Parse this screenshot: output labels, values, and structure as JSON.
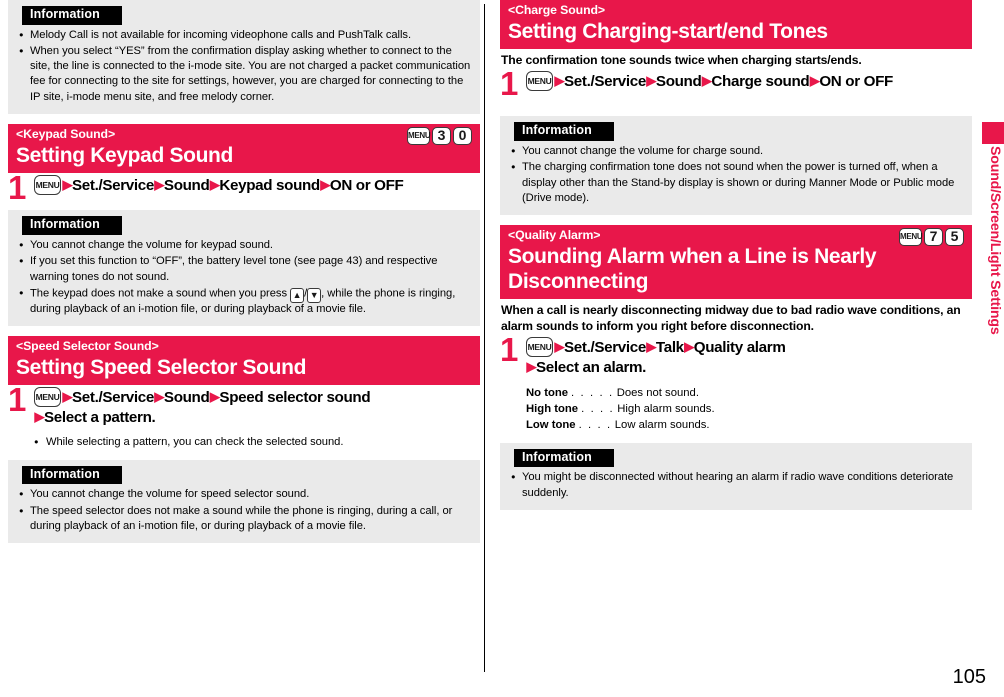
{
  "page": {
    "number": "105",
    "sidebar_label": "Sound/Screen/Light Settings",
    "accent_color": "#E8174A",
    "info_title": "Information"
  },
  "left_column": {
    "info_top": {
      "title": "Information",
      "bullets": [
        "Melody Call is not available for incoming videophone calls and PushTalk calls.",
        "When you select “YES” from the confirmation display asking whether to connect to the site, the line is connected to the i-mode site. You are not charged a packet communication fee for connecting to the site for settings, however, you are charged for connecting to the IP site, i-mode menu site, and free melody corner."
      ]
    },
    "section_keypad": {
      "subtitle": "<Keypad Sound>",
      "title": "Setting Keypad Sound",
      "keys": [
        "MENU",
        "3",
        "0"
      ],
      "step_number": "1",
      "step_menu_key": "MENU",
      "step_items": [
        "Set./Service",
        "Sound",
        "Keypad sound",
        "ON or OFF"
      ],
      "info": {
        "title": "Information",
        "bullets": [
          "You cannot change the volume for keypad sound.",
          "If you set this function to “OFF”, the battery level tone (see page 43) and respective warning tones do not sound.",
          "The keypad does not make a sound when you press ▲/▼, while the phone is ringing, during playback of an i-motion file, or during playback of a movie file."
        ],
        "bullet3_part1": "The keypad does not make a sound when you press ",
        "bullet3_part2": ", while the phone is ringing, during playback of an i-motion file, or during playback of a movie file.",
        "key_up": "▲",
        "key_down": "▼",
        "key_separator": "/"
      }
    },
    "section_speed_selector": {
      "subtitle": "<Speed Selector Sound>",
      "title": "Setting Speed Selector Sound",
      "step_number": "1",
      "step_menu_key": "MENU",
      "step_items": [
        "Set./Service",
        "Sound",
        "Speed selector sound"
      ],
      "step_line2": "Select a pattern.",
      "subnote": "While selecting a pattern, you can check the selected sound.",
      "info": {
        "title": "Information",
        "bullets": [
          "You cannot change the volume for speed selector sound.",
          "The speed selector does not make a sound while the phone is ringing, during a call, or during playback of an i-motion file, or during playback of a movie file."
        ]
      }
    }
  },
  "right_column": {
    "section_charge": {
      "subtitle": "<Charge Sound>",
      "title": "Setting Charging-start/end Tones",
      "lead": "The confirmation tone sounds twice when charging starts/ends.",
      "step_number": "1",
      "step_menu_key": "MENU",
      "step_items": [
        "Set./Service",
        "Sound",
        "Charge sound",
        "ON or OFF"
      ],
      "info": {
        "title": "Information",
        "bullets": [
          "You cannot change the volume for charge sound.",
          "The charging confirmation tone does not sound when the power is turned off, when a display other than the Stand-by display is shown or during Manner Mode or Public mode (Drive mode)."
        ]
      }
    },
    "section_quality_alarm": {
      "subtitle": "<Quality Alarm>",
      "title": "Sounding Alarm when a Line is Nearly Disconnecting",
      "keys": [
        "MENU",
        "7",
        "5"
      ],
      "lead": "When a call is nearly disconnecting midway due to bad radio wave conditions, an alarm sounds to inform you right before disconnection.",
      "step_number": "1",
      "step_menu_key": "MENU",
      "step_items": [
        "Set./Service",
        "Talk",
        "Quality alarm"
      ],
      "step_line2": "Select an alarm.",
      "options": [
        {
          "term": "No tone",
          "leader": ". . . . .",
          "desc": "Does not sound."
        },
        {
          "term": "High tone",
          "leader": ". . . .",
          "desc": "High alarm sounds."
        },
        {
          "term": "Low tone",
          "leader": ". . . .",
          "desc": "Low alarm sounds."
        }
      ],
      "info": {
        "title": "Information",
        "bullets": [
          "You might be disconnected without hearing an alarm if radio wave conditions deteriorate suddenly."
        ]
      }
    }
  }
}
